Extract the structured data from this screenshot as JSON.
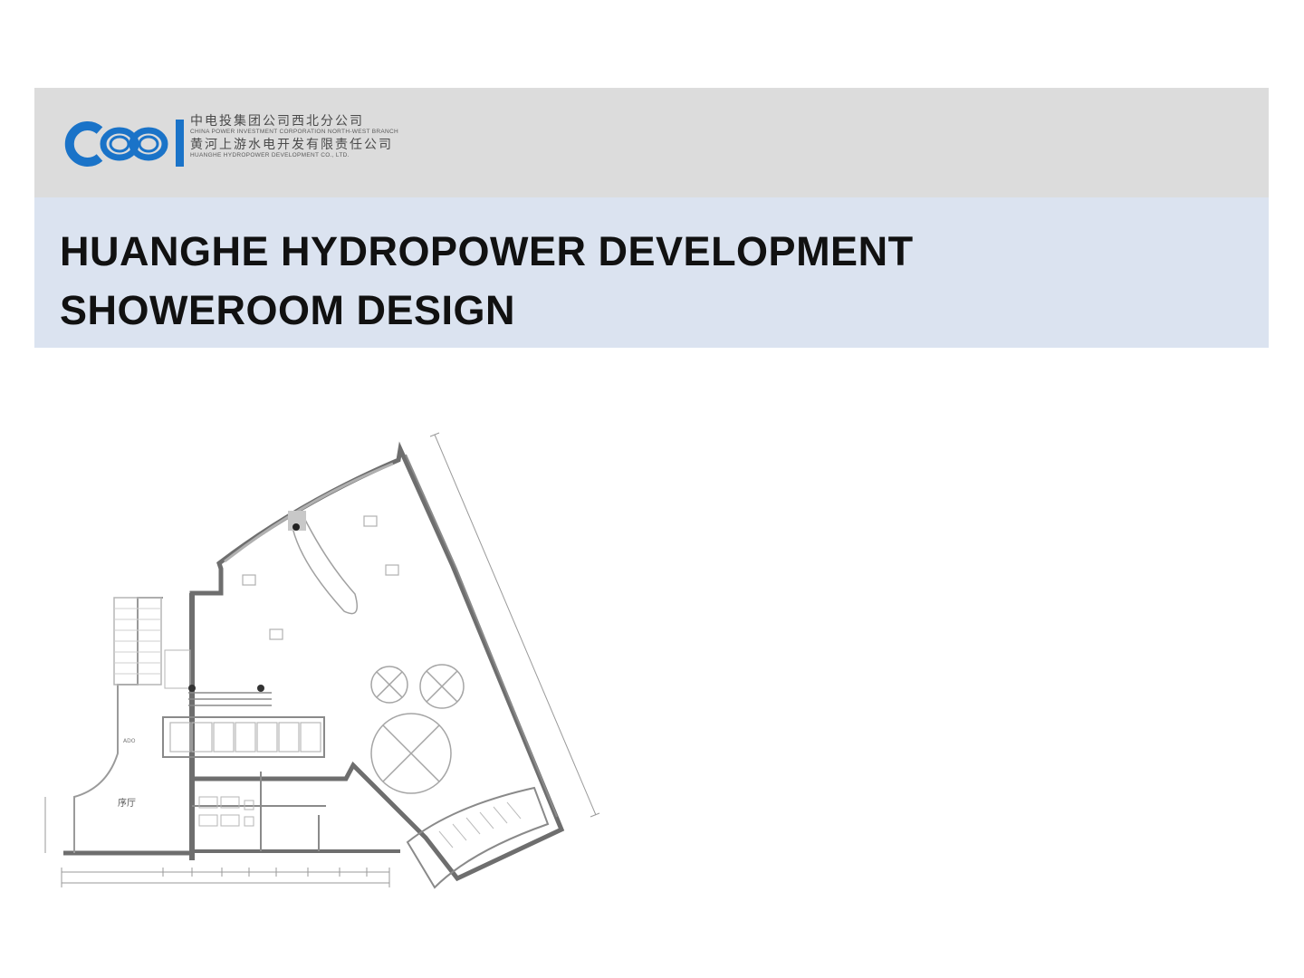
{
  "header": {
    "logo": {
      "icon": "cpi-logo-icon",
      "brand_color": "#1a73c8",
      "line1_cn": "中电投集团公司西北分公司",
      "line1_en": "CHINA POWER INVESTMENT CORPORATION NORTH-WEST BRANCH",
      "line2_cn": "黄河上游水电开发有限责任公司",
      "line2_en": "HUANGHE HYDROPOWER DEVELOPMENT CO., LTD."
    },
    "band_color": "#dcdcdc"
  },
  "title": {
    "line1": "HUANGHE HYDROPOWER DEVELOPMENT",
    "line2": "SHOWEROOM DESIGN",
    "band_color": "#dbe3f0"
  },
  "floor_plan": {
    "icon": "floor-plan-drawing",
    "room_label_lobby": "序厅",
    "room_label_ado": "ADO"
  }
}
